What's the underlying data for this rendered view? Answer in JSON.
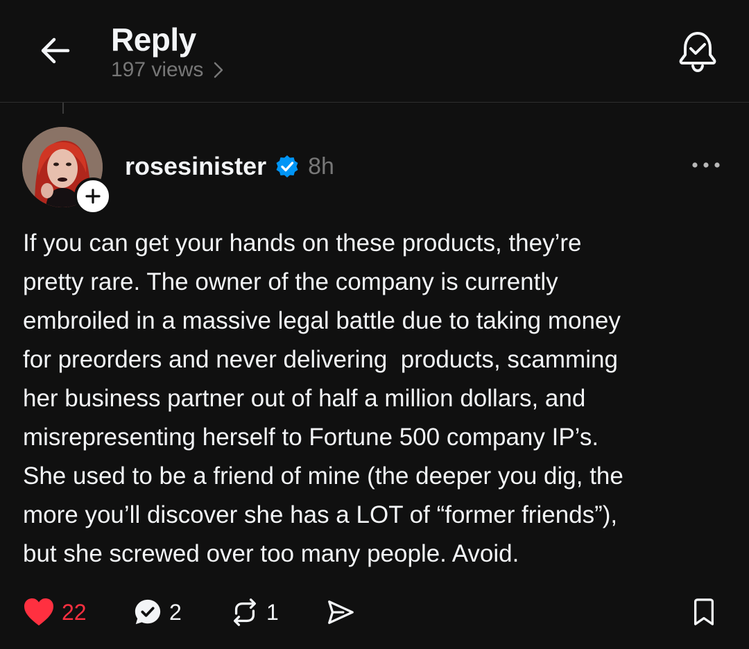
{
  "header": {
    "title": "Reply",
    "views": "197 views"
  },
  "post": {
    "username": "rosesinister",
    "verified": true,
    "time": "8h",
    "text_lines": [
      "If you can get your hands on these products, they’re",
      "pretty rare. The owner of the company is currently",
      "embroiled in a massive legal battle due to taking money",
      "for preorders and never delivering  products, scamming",
      "her business partner out of half a million dollars, and",
      "misrepresenting herself to Fortune 500 company IP’s.",
      "She used to be a friend of mine (the deeper you dig, the",
      "more you’ll discover she has a LOT of “former friends”),",
      "but she screwed over too many people. Avoid."
    ],
    "likes": "22",
    "replies": "2",
    "reposts": "1",
    "liked": true
  },
  "icons": {
    "back": "arrow-left-icon",
    "notify": "bell-check-icon",
    "verified": "verified-badge-icon",
    "more": "more-dots-icon",
    "like": "heart-filled-icon",
    "reply": "reply-bubble-icon",
    "repost": "repost-icon",
    "share": "send-icon",
    "bookmark": "bookmark-icon",
    "follow": "plus-icon",
    "chevron": "chevron-right-icon"
  },
  "colors": {
    "background": "#101010",
    "text": "#f3f5f7",
    "muted": "#777777",
    "like_red": "#ff3040",
    "verified_blue": "#0095f6"
  }
}
